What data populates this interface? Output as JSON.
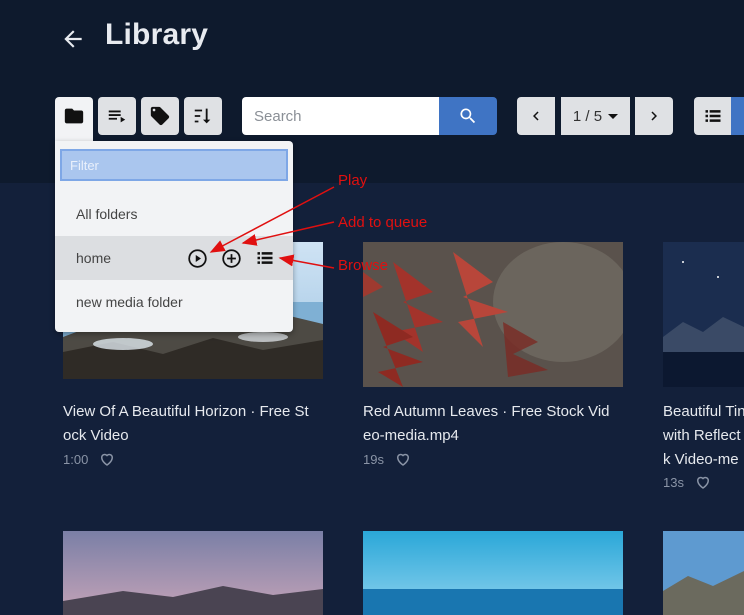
{
  "header": {
    "title": "Library",
    "back_icon": "arrow-left-icon"
  },
  "toolbar": {
    "folders_icon": "folder-icon",
    "queue_icon": "playlist-icon",
    "tags_icon": "tag-icon",
    "sort_icon": "sort-icon",
    "search_placeholder": "Search",
    "search_icon": "search-icon",
    "pagination": {
      "prev_icon": "chevron-left-icon",
      "current": "1 / 5",
      "next_icon": "chevron-right-icon"
    },
    "view_icon": "list-view-icon"
  },
  "folder_dropdown": {
    "filter_placeholder": "Filter",
    "items": [
      {
        "label": "All folders"
      },
      {
        "label": "home"
      },
      {
        "label": "new media folder"
      }
    ]
  },
  "annotations": {
    "play": "Play",
    "add_to_queue": "Add to queue",
    "browse": "Browse",
    "color": "#e01010"
  },
  "media": [
    {
      "title": "View Of A Beautiful Horizon · Free St ock Video",
      "duration": "1:00"
    },
    {
      "title": "Red Autumn Leaves · Free Stock Vid eo-media.mp4",
      "duration": "19s"
    },
    {
      "title_line1": "Beautiful Tin",
      "title_line2": "with Reflect",
      "title_line3": "k Video-me",
      "duration": "13s"
    }
  ],
  "colors": {
    "background": "#13203a",
    "header": "#0e1a2d",
    "accent": "#3f74c4"
  }
}
